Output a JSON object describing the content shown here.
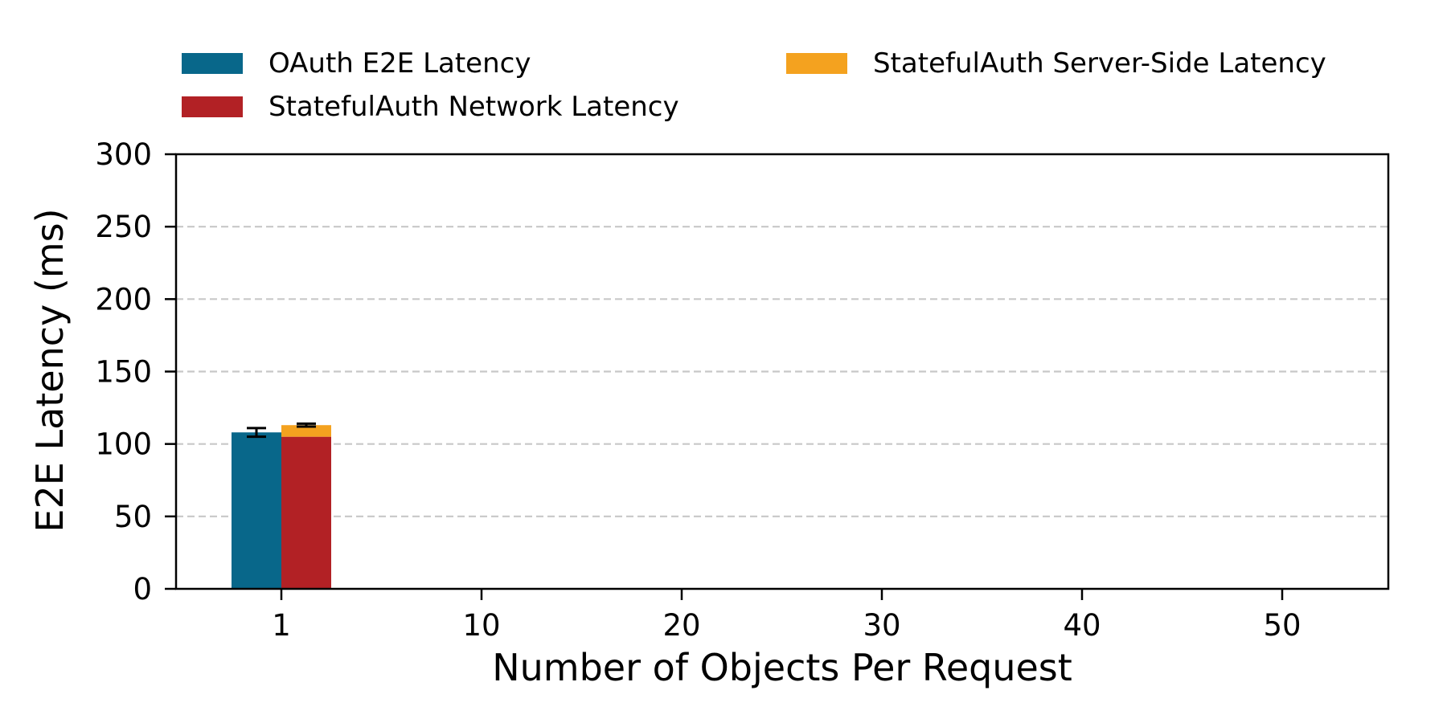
{
  "chart_data": {
    "type": "bar",
    "categories": [
      "1",
      "10",
      "20",
      "30",
      "40",
      "50"
    ],
    "series": [
      {
        "name": "OAuth E2E Latency",
        "values": [
          108,
          0,
          0,
          0,
          0,
          0
        ],
        "errors": [
          3,
          0,
          0,
          0,
          0,
          0
        ],
        "color": "#08678a"
      },
      {
        "name": "StatefulAuth Network Latency",
        "values": [
          105,
          0,
          0,
          0,
          0,
          0
        ],
        "color": "#b22125"
      },
      {
        "name": "StatefulAuth Server-Side Latency",
        "values": [
          8,
          0,
          0,
          0,
          0,
          0
        ],
        "errors": [
          1,
          0,
          0,
          0,
          0,
          0
        ],
        "color": "#f4a21f"
      }
    ],
    "stacked_series": [
      "StatefulAuth Network Latency",
      "StatefulAuth Server-Side Latency"
    ],
    "xlabel": "Number of Objects Per Request",
    "ylabel": "E2E Latency (ms)",
    "ylim": [
      0,
      300
    ],
    "yticks": [
      0,
      50,
      100,
      150,
      200,
      250,
      300
    ],
    "grid": "horizontal dashed",
    "legend_position": "top"
  }
}
